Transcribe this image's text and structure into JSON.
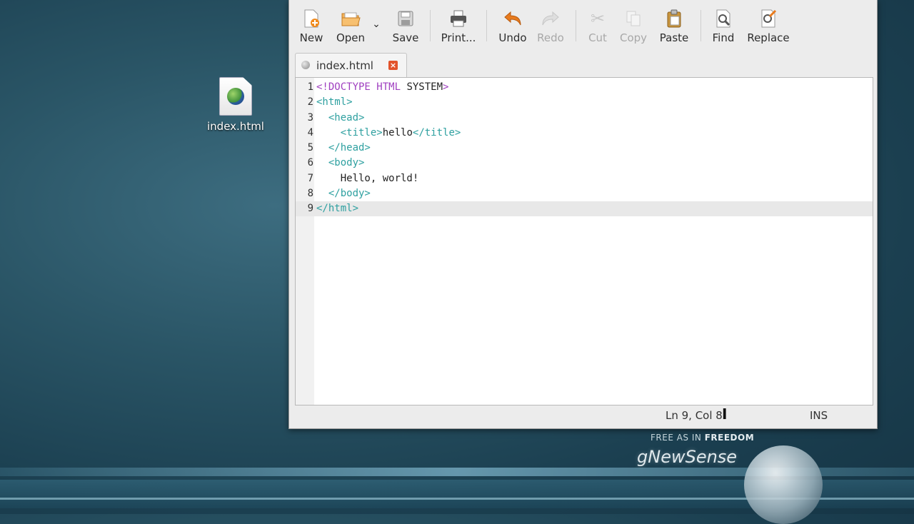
{
  "desktop": {
    "icon_label": "index.html"
  },
  "toolbar": {
    "new_label": "New",
    "open_label": "Open",
    "open_dropdown_glyph": "⌄",
    "save_label": "Save",
    "print_label": "Print...",
    "undo_label": "Undo",
    "redo_label": "Redo",
    "cut_label": "Cut",
    "copy_label": "Copy",
    "paste_label": "Paste",
    "find_label": "Find",
    "replace_label": "Replace"
  },
  "tab": {
    "label": "index.html",
    "close_glyph": "×"
  },
  "editor": {
    "current_line": 9,
    "lines": [
      {
        "n": "1",
        "indent": "",
        "segments": [
          [
            "kw",
            "<!DOCTYPE HTML "
          ],
          [
            "txt",
            "SYSTEM"
          ],
          [
            "kw",
            ">"
          ]
        ]
      },
      {
        "n": "2",
        "indent": "",
        "segments": [
          [
            "tag",
            "<html>"
          ]
        ]
      },
      {
        "n": "3",
        "indent": "  ",
        "segments": [
          [
            "tag",
            "<head>"
          ]
        ]
      },
      {
        "n": "4",
        "indent": "    ",
        "segments": [
          [
            "tag",
            "<title>"
          ],
          [
            "txt",
            "hello"
          ],
          [
            "tag",
            "</title>"
          ]
        ]
      },
      {
        "n": "5",
        "indent": "  ",
        "segments": [
          [
            "tag",
            "</head>"
          ]
        ]
      },
      {
        "n": "6",
        "indent": "  ",
        "segments": [
          [
            "tag",
            "<body>"
          ]
        ]
      },
      {
        "n": "7",
        "indent": "    ",
        "segments": [
          [
            "txt",
            "Hello, world!"
          ]
        ]
      },
      {
        "n": "8",
        "indent": "  ",
        "segments": [
          [
            "tag",
            "</body>"
          ]
        ]
      },
      {
        "n": "9",
        "indent": "",
        "segments": [
          [
            "tag",
            "</html>"
          ]
        ]
      }
    ]
  },
  "status": {
    "position": "Ln 9, Col 8",
    "mode": "INS"
  },
  "branding": {
    "tagline_prefix": "FREE AS IN ",
    "tagline_bold": "FREEDOM",
    "name": "gNewSense"
  },
  "colors": {
    "keyword": "#a040c0",
    "tag": "#2ea0a0",
    "close_button": "#e2532b"
  }
}
